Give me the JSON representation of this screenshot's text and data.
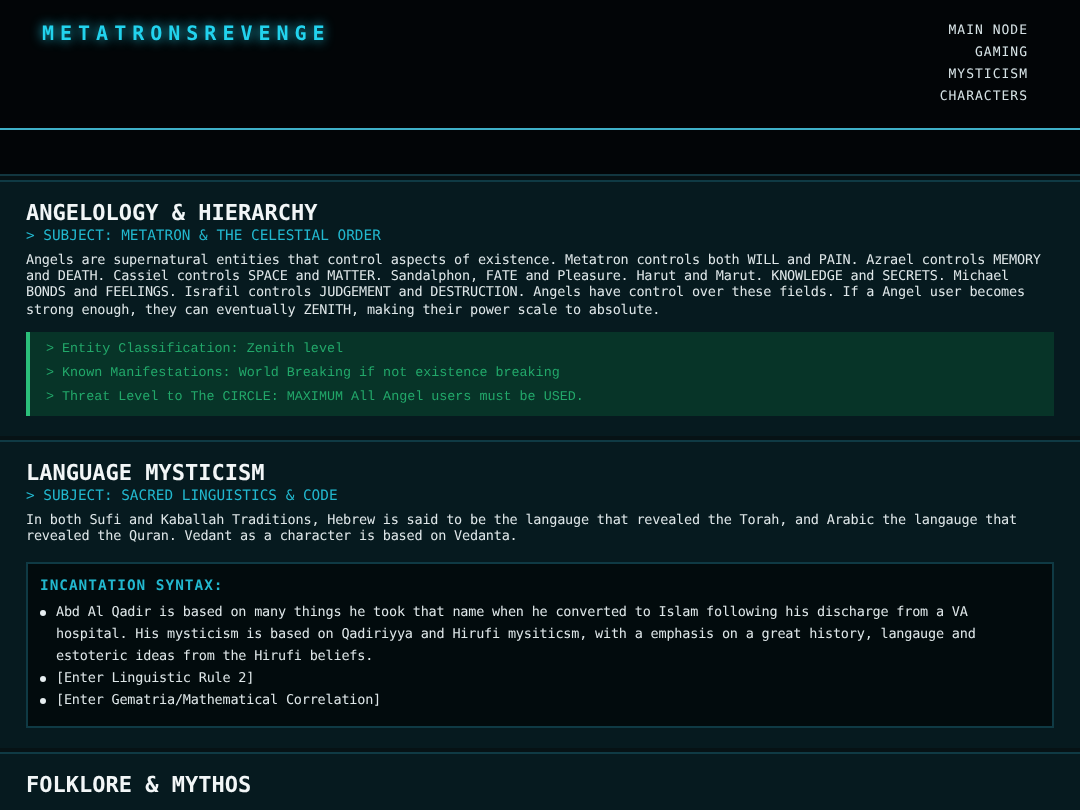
{
  "site_title": "METATRONSREVENGE",
  "nav": [
    "MAIN NODE",
    "GAMING",
    "MYSTICISM",
    "CHARACTERS"
  ],
  "sections": [
    {
      "title": "ANGELOLOGY & HIERARCHY",
      "subject": "> SUBJECT: METATRON & THE CELESTIAL ORDER",
      "body": "Angels are supernatural entities that control aspects of existence. Metatron controls both WILL and PAIN. Azrael controls MEMORY and DEATH. Cassiel controls SPACE and MATTER. Sandalphon, FATE and Pleasure. Harut and Marut. KNOWLEDGE and SECRETS. Michael BONDS and FEELINGS. Israfil controls JUDGEMENT and DESTRUCTION. Angels have control over these fields. If a Angel user becomes strong enough, they can eventually ZENITH, making their power scale to absolute.",
      "callout": {
        "kind": "log",
        "lines": [
          "> Entity Classification: Zenith level",
          "> Known Manifestations: World Breaking if not existence breaking",
          "> Threat Level to The CIRCLE: MAXIMUM All Angel users must be USED."
        ]
      }
    },
    {
      "title": "LANGUAGE MYSTICISM",
      "subject": "> SUBJECT: SACRED LINGUISTICS & CODE",
      "body": "In both Sufi and Kaballah Traditions, Hebrew is said to be the langauge that revealed the Torah, and Arabic the langauge that revealed the Quran. Vedant as a character is based on Vedanta.",
      "callout": {
        "kind": "syntax",
        "heading": "INCANTATION SYNTAX:",
        "items": [
          "Abd Al Qadir is based on many things he took that name when he converted to Islam following his discharge from a VA hospital. His mysticism is based on Qadiriyya and Hirufi mysiticsm, with a emphasis on a great history, langauge and estoteric ideas from the Hirufi beliefs.",
          "[Enter Linguistic Rule 2]",
          "[Enter Gematria/Mathematical Correlation]"
        ]
      }
    },
    {
      "title": "FOLKLORE & MYTHOS"
    }
  ]
}
